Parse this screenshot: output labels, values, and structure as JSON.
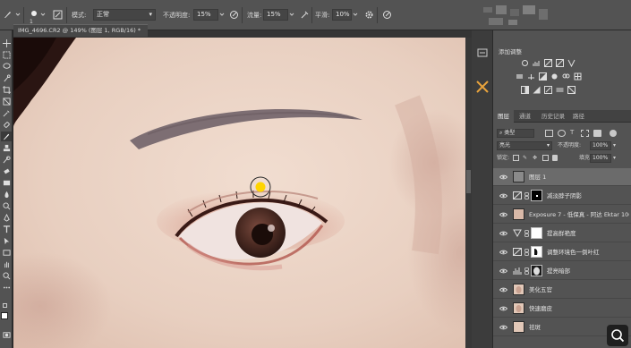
{
  "options_bar": {
    "mode_label": "模式:",
    "mode_value": "正常",
    "opacity_label": "不透明度:",
    "opacity_value": "15%",
    "flow_label": "流量:",
    "flow_value": "15%",
    "smooth_label": "平滑:",
    "smooth_value": "10%",
    "brush_size": "1"
  },
  "document": {
    "tab_title": "IMG_4696.CR2 @ 149% (图层 1, RGB/16) *"
  },
  "adjustments": {
    "header": "添加调整"
  },
  "layers_panel": {
    "tabs": [
      "图层",
      "通道",
      "历史记录",
      "路径"
    ],
    "filter_kind": "类型",
    "blend_mode": "亮光",
    "opacity_label": "不透明度:",
    "opacity_value": "100%",
    "lock_label": "锁定:",
    "fill_label": "填充:",
    "fill_value": "100%",
    "layers": [
      {
        "name": "图层 1",
        "selected": true,
        "type": "pixel"
      },
      {
        "name": "减淡脖子阴影",
        "selected": false,
        "type": "curves-mask-black"
      },
      {
        "name": "Exposure 7 - 低保真 - 阿达 Ektar 100",
        "selected": false,
        "type": "smart-photo"
      },
      {
        "name": "提高鲜艳度",
        "selected": false,
        "type": "vibrance-mask-white"
      },
      {
        "name": "调整环境色一倒叶红",
        "selected": false,
        "type": "curves-mask-shape"
      },
      {
        "name": "提亮暗部",
        "selected": false,
        "type": "levels-mask-face"
      },
      {
        "name": "美化五官",
        "selected": false,
        "type": "photo"
      },
      {
        "name": "快速磨皮",
        "selected": false,
        "type": "photo"
      },
      {
        "name": "祛斑",
        "selected": false,
        "type": "photo"
      }
    ]
  },
  "colors": {
    "panel_bg": "#535353",
    "accent_orange": "#e8a33c",
    "cursor_yellow": "#ffd400"
  }
}
